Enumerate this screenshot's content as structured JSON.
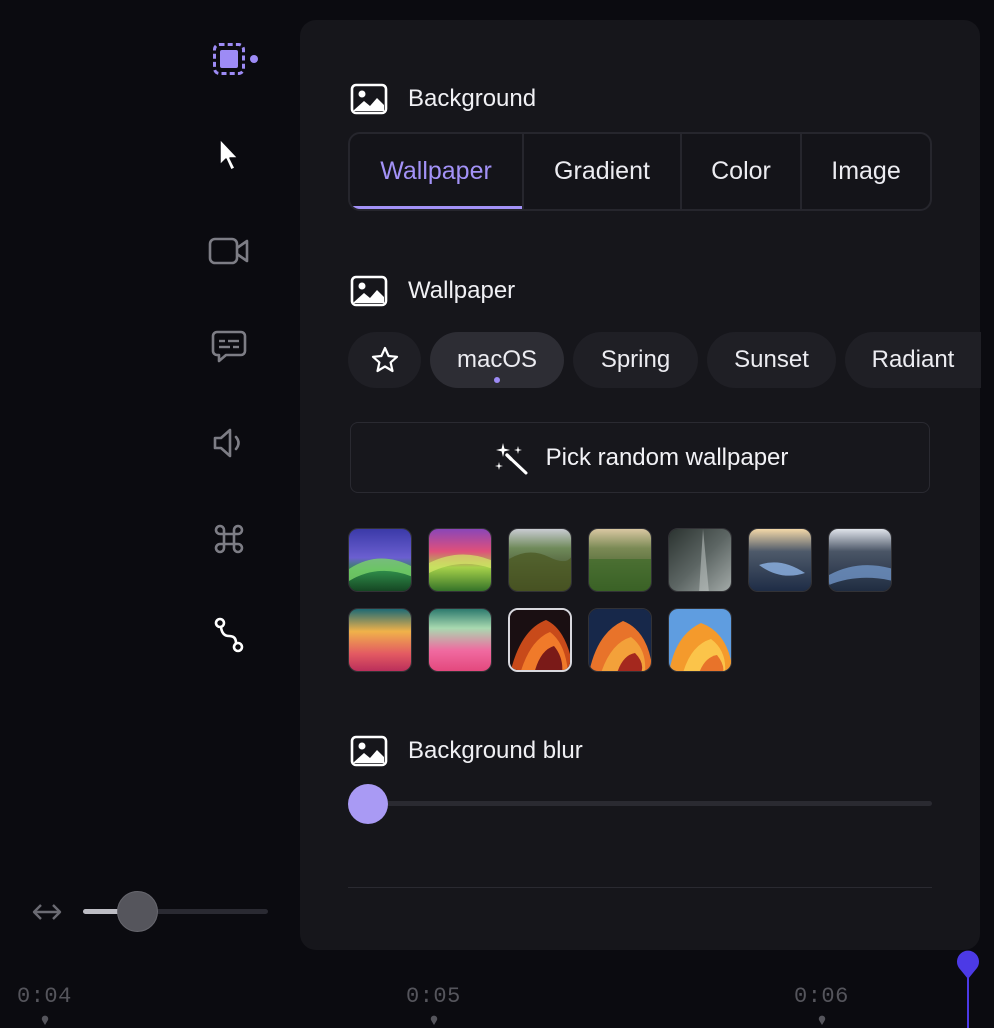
{
  "rail": {
    "tools": [
      {
        "name": "selection-icon",
        "active": true
      },
      {
        "name": "cursor-icon"
      },
      {
        "name": "camera-icon"
      },
      {
        "name": "captions-icon"
      },
      {
        "name": "audio-icon"
      },
      {
        "name": "keyboard-shortcut-icon"
      },
      {
        "name": "path-icon"
      }
    ],
    "zoom": {
      "icon": "resize-horizontal-icon",
      "level": 0.3
    }
  },
  "background": {
    "title": "Background",
    "tabs": [
      {
        "label": "Wallpaper",
        "active": true
      },
      {
        "label": "Gradient"
      },
      {
        "label": "Color"
      },
      {
        "label": "Image"
      }
    ]
  },
  "wallpaper": {
    "title": "Wallpaper",
    "favorites_icon": "star-icon",
    "categories": [
      {
        "label": "macOS",
        "active": true
      },
      {
        "label": "Spring"
      },
      {
        "label": "Sunset"
      },
      {
        "label": "Radiant"
      }
    ],
    "random_button": "Pick random wallpaper",
    "random_icon": "magic-wand-icon",
    "selected_index": 9
  },
  "blur": {
    "title": "Background blur",
    "value": 0
  },
  "timeline": {
    "labels": [
      "0:04",
      "0:05",
      "0:06"
    ]
  },
  "colors": {
    "accent": "#a392f7",
    "playhead": "#4c3ae6",
    "panel": "#16161b",
    "background": "#0b0b10"
  }
}
